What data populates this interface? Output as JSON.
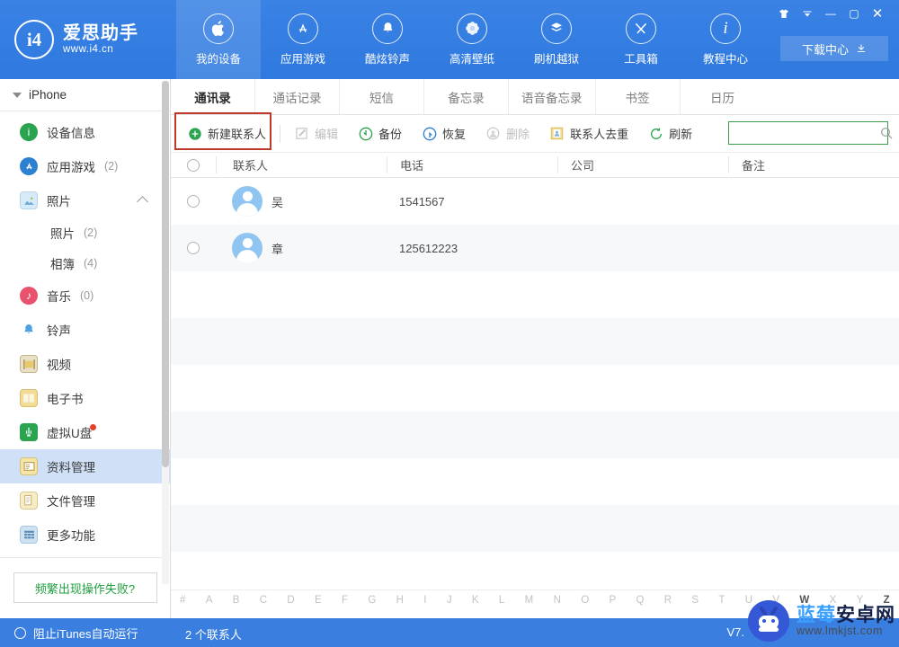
{
  "app": {
    "logo_title": "爱思助手",
    "logo_url": "www.i4.cn",
    "logo_mark": "i4",
    "accent_blue": "#3a7fe0",
    "accent_green": "#3d9b4f",
    "highlight_red": "#c0392b"
  },
  "window": {
    "buttons": [
      {
        "name": "skin-button",
        "glyph": "👕"
      },
      {
        "name": "menu-dropdown-button",
        "glyph": "▾"
      },
      {
        "name": "minimize-button",
        "glyph": "—"
      },
      {
        "name": "maximize-button",
        "glyph": "▢"
      },
      {
        "name": "close-button",
        "glyph": "✕"
      }
    ],
    "download_center": "下载中心"
  },
  "topnav": {
    "items": [
      {
        "label": "我的设备",
        "icon": "apple-icon",
        "glyph": "",
        "active": true
      },
      {
        "label": "应用游戏",
        "icon": "appstore-icon",
        "glyph": "A",
        "active": false
      },
      {
        "label": "酷炫铃声",
        "icon": "bell-icon",
        "glyph": "🔔",
        "active": false
      },
      {
        "label": "高清壁纸",
        "icon": "flower-icon",
        "glyph": "✿",
        "active": false
      },
      {
        "label": "刷机越狱",
        "icon": "flash-box-icon",
        "glyph": "⬇",
        "active": false
      },
      {
        "label": "工具箱",
        "icon": "tools-icon",
        "glyph": "✕",
        "active": false
      },
      {
        "label": "教程中心",
        "icon": "info-icon",
        "glyph": "i",
        "active": false
      }
    ]
  },
  "sidebar": {
    "device": "iPhone",
    "items": [
      {
        "label": "设备信息",
        "count": "",
        "icon": "info-circle-icon",
        "color": "#2aa44f",
        "shape": "rnd",
        "glyph": "i",
        "selected": false,
        "sub": false
      },
      {
        "label": "应用游戏",
        "count": "(2)",
        "icon": "appstore-icon",
        "color": "#2d7fd1",
        "shape": "rnd",
        "glyph": "A",
        "selected": false,
        "sub": false
      },
      {
        "label": "照片",
        "count": "",
        "icon": "photo-icon",
        "color": "#c9e3f7",
        "shape": "sq",
        "glyph": "▲",
        "selected": false,
        "sub": false,
        "chevron": true
      },
      {
        "label": "照片",
        "count": "(2)",
        "icon": "photo-sub-icon",
        "color": "",
        "shape": "none",
        "glyph": "",
        "selected": false,
        "sub": true
      },
      {
        "label": "相簿",
        "count": "(4)",
        "icon": "album-sub-icon",
        "color": "",
        "shape": "none",
        "glyph": "",
        "selected": false,
        "sub": true
      },
      {
        "label": "音乐",
        "count": "(0)",
        "icon": "music-icon",
        "color": "#e8526d",
        "shape": "rnd",
        "glyph": "♪",
        "selected": false,
        "sub": false
      },
      {
        "label": "铃声",
        "count": "",
        "icon": "ringtone-bell-icon",
        "color": "#4aa3e8",
        "shape": "none",
        "glyph": "🔔",
        "selected": false,
        "sub": false
      },
      {
        "label": "视频",
        "count": "",
        "icon": "video-icon",
        "color": "#c8b68a",
        "shape": "sq",
        "glyph": "▦",
        "selected": false,
        "sub": false
      },
      {
        "label": "电子书",
        "count": "",
        "icon": "ebook-icon",
        "color": "#e8c96a",
        "shape": "sq",
        "glyph": "▤",
        "selected": false,
        "sub": false
      },
      {
        "label": "虚拟U盘",
        "count": "",
        "icon": "usb-shield-icon",
        "color": "#2aa44f",
        "shape": "sq",
        "glyph": "⊍",
        "selected": false,
        "sub": false,
        "badge": true
      },
      {
        "label": "资料管理",
        "count": "",
        "icon": "data-manage-icon",
        "color": "#f0d98a",
        "shape": "sq",
        "glyph": "▤",
        "selected": true,
        "sub": false
      },
      {
        "label": "文件管理",
        "count": "",
        "icon": "file-manage-icon",
        "color": "#f0e2b8",
        "shape": "sq",
        "glyph": "▤",
        "selected": false,
        "sub": false
      },
      {
        "label": "更多功能",
        "count": "",
        "icon": "more-features-icon",
        "color": "#b9d4ea",
        "shape": "sq",
        "glyph": "▦",
        "selected": false,
        "sub": false
      }
    ],
    "fail_button": "频繁出现操作失败?"
  },
  "tabs": [
    {
      "label": "通讯录",
      "active": true
    },
    {
      "label": "通话记录",
      "active": false
    },
    {
      "label": "短信",
      "active": false
    },
    {
      "label": "备忘录",
      "active": false
    },
    {
      "label": "语音备忘录",
      "active": false
    },
    {
      "label": "书签",
      "active": false
    },
    {
      "label": "日历",
      "active": false
    }
  ],
  "toolbar": {
    "buttons": [
      {
        "label": "新建联系人",
        "icon": "plus-circle-icon",
        "color": "#2aa44f",
        "glyph": "+",
        "disabled": false,
        "highlighted": true
      },
      {
        "label": "编辑",
        "icon": "edit-pencil-icon",
        "color": "#c4c4c4",
        "glyph": "✎",
        "disabled": true,
        "highlighted": false
      },
      {
        "label": "备份",
        "icon": "backup-icon",
        "color": "#2aa44f",
        "glyph": "↻",
        "disabled": false,
        "highlighted": false
      },
      {
        "label": "恢复",
        "icon": "restore-icon",
        "color": "#2d7fd1",
        "glyph": "↺",
        "disabled": false,
        "highlighted": false
      },
      {
        "label": "删除",
        "icon": "delete-icon",
        "color": "#c4c4c4",
        "glyph": "⊗",
        "disabled": true,
        "highlighted": false
      },
      {
        "label": "联系人去重",
        "icon": "dedupe-icon",
        "color": "#e0b84a",
        "glyph": "▤",
        "disabled": false,
        "highlighted": false
      },
      {
        "label": "刷新",
        "icon": "refresh-icon",
        "color": "#2aa44f",
        "glyph": "↻",
        "disabled": false,
        "highlighted": false
      }
    ],
    "search_value": "",
    "search_placeholder": ""
  },
  "table": {
    "columns": [
      "联系人",
      "电话",
      "公司",
      "备注"
    ],
    "rows": [
      {
        "name": "吴",
        "phone": "1541567",
        "company": "",
        "note": "",
        "checked": false
      },
      {
        "name": "章",
        "phone": "125612223",
        "company": "",
        "note": "",
        "checked": false
      }
    ]
  },
  "alpha_index": {
    "letters": [
      "#",
      "A",
      "B",
      "C",
      "D",
      "E",
      "F",
      "G",
      "H",
      "I",
      "J",
      "K",
      "L",
      "M",
      "N",
      "O",
      "P",
      "Q",
      "R",
      "S",
      "T",
      "U",
      "V",
      "W",
      "X",
      "Y",
      "Z"
    ],
    "active": [
      "W",
      "Z"
    ]
  },
  "statusbar": {
    "itunes_toggle": "阻止iTunes自动运行",
    "count_text": "2 个联系人",
    "version": "V7."
  },
  "watermark": {
    "title_blue": "蓝莓",
    "title_dark": "安卓网",
    "url": "www.lmkjst.com"
  }
}
